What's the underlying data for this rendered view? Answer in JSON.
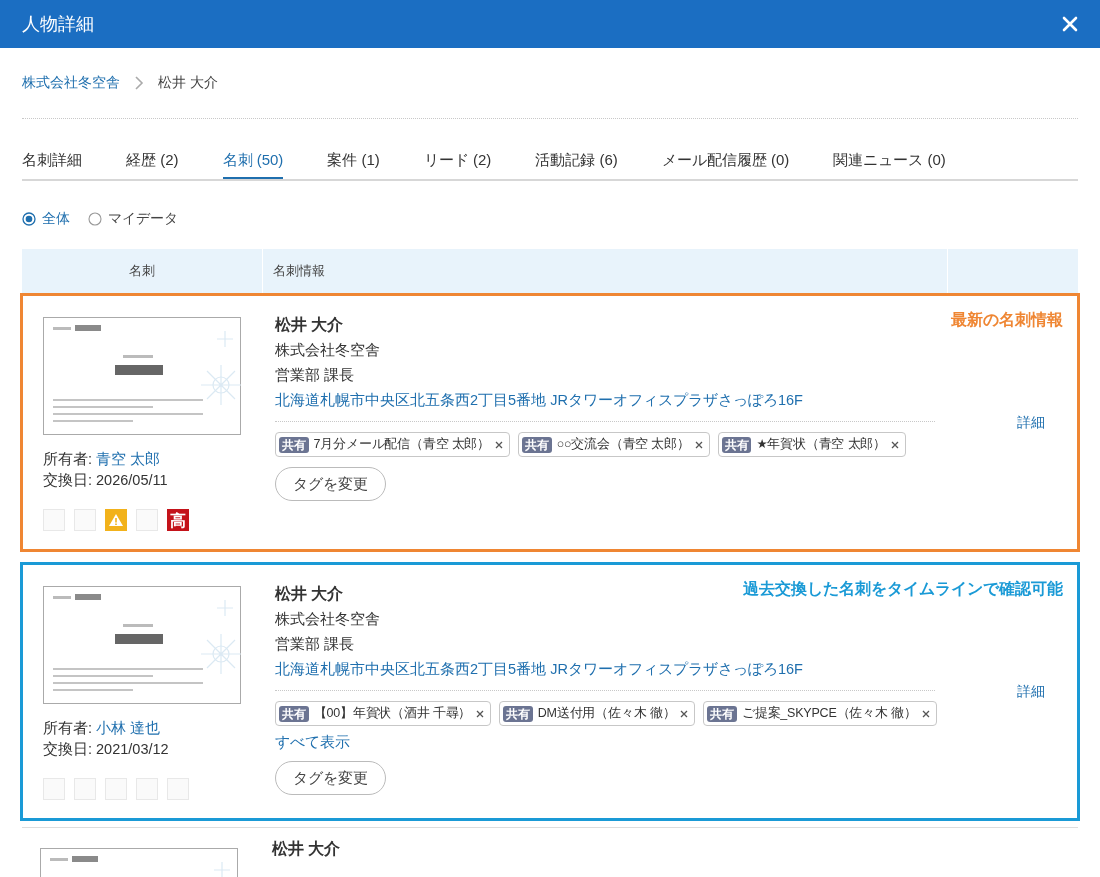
{
  "window": {
    "title": "人物詳細"
  },
  "breadcrumb": [
    {
      "label": "株式会社冬空舎"
    },
    {
      "label": "松井 大介"
    }
  ],
  "tabs": [
    {
      "label": "名刺詳細",
      "selected": false
    },
    {
      "label": "経歴 (2)",
      "selected": false
    },
    {
      "label": "名刺 (50)",
      "selected": true
    },
    {
      "label": "案件 (1)",
      "selected": false
    },
    {
      "label": "リード (2)",
      "selected": false
    },
    {
      "label": "活動記録 (6)",
      "selected": false
    },
    {
      "label": "メール配信履歴 (0)",
      "selected": false
    },
    {
      "label": "関連ニュース (0)",
      "selected": false
    }
  ],
  "filter": [
    {
      "label": "全体",
      "selected": true
    },
    {
      "label": "マイデータ",
      "selected": false
    }
  ],
  "table": {
    "columns": [
      "名刺",
      "名刺情報"
    ],
    "rows": [
      {
        "owner_label": "所有者:",
        "owner": "青空 太郎",
        "date_label": "交換日:",
        "date": "2026/05/11",
        "flags": [
          {
            "kind": "empty"
          },
          {
            "kind": "empty"
          },
          {
            "kind": "warning"
          },
          {
            "kind": "empty"
          },
          {
            "kind": "priority",
            "label": "高"
          }
        ],
        "name": "松井 大介",
        "company": "株式会社冬空舎",
        "position": "営業部 課長",
        "address": "北海道札幌市中央区北五条西2丁目5番地 JRタワーオフィスプラザさっぽろ16F",
        "tags": [
          {
            "badge": "共有",
            "label": "7月分メール配信（青空 太郎）"
          },
          {
            "badge": "共有",
            "label": "○○交流会（青空 太郎）"
          },
          {
            "badge": "共有",
            "label": "★年賀状（青空 太郎）"
          }
        ],
        "change_tags": "タグを変更",
        "detail": "詳細",
        "highlight": {
          "color": "#ef8633",
          "note": "最新の名刺情報"
        }
      },
      {
        "owner_label": "所有者:",
        "owner": "小林 達也",
        "date_label": "交換日:",
        "date": "2021/03/12",
        "flags": [
          {
            "kind": "empty"
          },
          {
            "kind": "empty"
          },
          {
            "kind": "empty"
          },
          {
            "kind": "empty"
          },
          {
            "kind": "empty"
          }
        ],
        "name": "松井 大介",
        "company": "株式会社冬空舎",
        "position": "営業部 課長",
        "address": "北海道札幌市中央区北五条西2丁目5番地 JRタワーオフィスプラザさっぽろ16F",
        "tags": [
          {
            "badge": "共有",
            "label": "【00】年賀状（酒井 千尋）"
          },
          {
            "badge": "共有",
            "label": "DM送付用（佐々木 徹）"
          },
          {
            "badge": "共有",
            "label": "ご提案_SKYPCE（佐々木 徹）"
          }
        ],
        "show_all": "すべて表示",
        "change_tags": "タグを変更",
        "detail": "詳細",
        "highlight": {
          "color": "#1a9ad6",
          "note": "過去交換した名刺をタイムラインで確認可能"
        }
      },
      {
        "name": "松井 大介"
      }
    ]
  }
}
